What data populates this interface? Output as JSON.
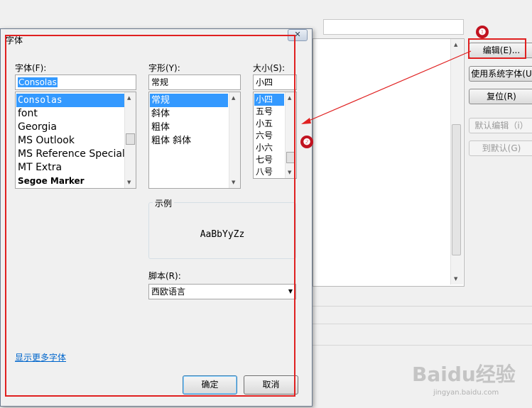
{
  "dialog": {
    "title": "字体",
    "close_glyph": "✕",
    "font_label": "字体(F):",
    "font_value": "Consolas",
    "font_list": [
      "Consolas",
      "font",
      "Georgia",
      "MS Outlook",
      "MS Reference Specialty",
      "MT Extra",
      "Segoe Marker"
    ],
    "style_label": "字形(Y):",
    "style_value": "常规",
    "style_list": [
      "常规",
      "斜体",
      "粗体",
      "粗体 斜体"
    ],
    "size_label": "大小(S):",
    "size_value": "小四",
    "size_list": [
      "小四",
      "五号",
      "小五",
      "六号",
      "小六",
      "七号",
      "八号"
    ],
    "sample_label": "示例",
    "sample_text": "AaBbYyZz",
    "script_label": "脚本(R):",
    "script_value": "西欧语言",
    "more_fonts_link": "显示更多字体",
    "ok_label": "确定",
    "cancel_label": "取消"
  },
  "background": {
    "buttons": [
      "编辑(E)...",
      "使用系统字体(U",
      "复位(R)",
      "默认编辑（i）",
      "到默认(G)"
    ]
  },
  "annotations": {
    "badge_1": "❶",
    "badge_2": "❷",
    "highlight_color": "#e02020"
  },
  "watermark": {
    "brand": "Baidu经验",
    "url": "jingyan.baidu.com"
  },
  "colors": {
    "selection": "#3399ff",
    "link": "#0066cc"
  }
}
